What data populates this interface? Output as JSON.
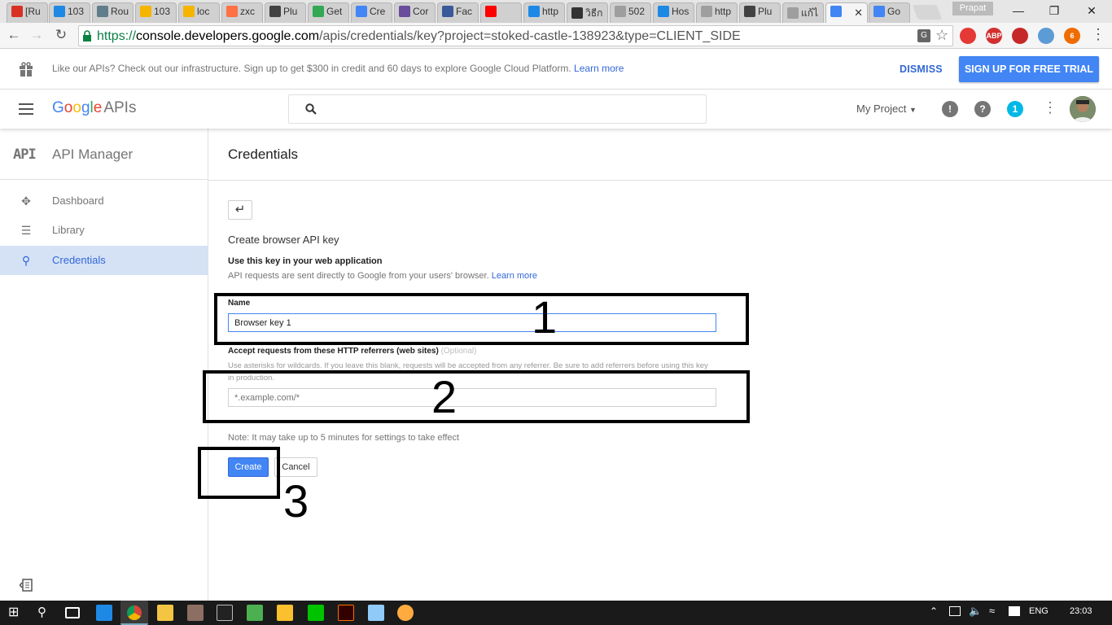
{
  "browser": {
    "tabs": [
      {
        "label": "[Ru",
        "color": "#d93025",
        "icon": "gmail-icon"
      },
      {
        "label": "103",
        "color": "#1e88e5",
        "icon": "site-icon"
      },
      {
        "label": "Rou",
        "color": "#607d8b",
        "icon": "router-icon"
      },
      {
        "label": "103",
        "color": "#f4b400",
        "icon": "pma-icon"
      },
      {
        "label": "loc",
        "color": "#f4b400",
        "icon": "pma-icon"
      },
      {
        "label": "zxc",
        "color": "#ff7043",
        "icon": "site-icon"
      },
      {
        "label": "Plu",
        "color": "#424242",
        "icon": "plugin-icon"
      },
      {
        "label": "Get",
        "color": "#34a853",
        "icon": "site-icon"
      },
      {
        "label": "Cre",
        "color": "#4285f4",
        "icon": "google-icon"
      },
      {
        "label": "Cor",
        "color": "#6a4c9c",
        "icon": "bootstrap-icon"
      },
      {
        "label": "Fac",
        "color": "#3b5998",
        "icon": "facebook-icon"
      },
      {
        "label": "",
        "color": "#ff0000",
        "icon": "youtube-icon"
      },
      {
        "label": "http",
        "color": "#1e88e5",
        "icon": "bird-icon"
      },
      {
        "label": "วิธีก",
        "color": "#333333",
        "icon": "site-icon"
      },
      {
        "label": "502",
        "color": "#9e9e9e",
        "icon": "page-icon"
      },
      {
        "label": "Hos",
        "color": "#1e88e5",
        "icon": "site-icon"
      },
      {
        "label": "http",
        "color": "#9e9e9e",
        "icon": "page-icon"
      },
      {
        "label": "Plu",
        "color": "#424242",
        "icon": "plugin-icon"
      },
      {
        "label": "แก้ไ",
        "color": "#9e9e9e",
        "icon": "page-icon"
      },
      {
        "label": "",
        "color": "#4285f4",
        "icon": "google-icon",
        "active": true
      },
      {
        "label": "Go",
        "color": "#4285f4",
        "icon": "google-icon"
      }
    ],
    "profile_name": "Prapat",
    "url_scheme": "https://",
    "url_host": "console.developers.google.com",
    "url_path": "/apis/credentials/key?project=stoked-castle-138923&type=CLIENT_SIDE",
    "extensions": [
      {
        "icon": "opera-icon",
        "label": "",
        "color": "#e53935"
      },
      {
        "icon": "adblock-icon",
        "label": "ABP",
        "color": "#d32f2f"
      },
      {
        "icon": "fastforward-icon",
        "label": "",
        "color": "#c62828"
      },
      {
        "icon": "extension-icon",
        "label": "",
        "color": "#5c9bd5"
      },
      {
        "icon": "extension-badge-icon",
        "label": "6",
        "color": "#ef6c00"
      }
    ]
  },
  "promo": {
    "text": "Like our APIs? Check out our infrastructure. Sign up to get $300 in credit and 60 days to explore Google Cloud Platform.",
    "link": "Learn more",
    "dismiss": "DISMISS",
    "signup": "SIGN UP FOR FREE TRIAL"
  },
  "header": {
    "logo_google": "Google",
    "logo_apis": "APIs",
    "project": "My Project",
    "notification_count": "1"
  },
  "sidebar": {
    "badge": "API",
    "title": "API Manager",
    "items": [
      {
        "label": "Dashboard",
        "icon": "dashboard-icon"
      },
      {
        "label": "Library",
        "icon": "library-icon"
      },
      {
        "label": "Credentials",
        "icon": "key-icon",
        "selected": true
      }
    ]
  },
  "main": {
    "title": "Credentials",
    "form_title": "Create browser API key",
    "use_key": "Use this key in your web application",
    "api_requests": "API requests are sent directly to Google from your users' browser.",
    "learn_more": "Learn more",
    "name_label": "Name",
    "name_value": "Browser key 1",
    "referrers_label": "Accept requests from these HTTP referrers (web sites)",
    "optional": "(Optional)",
    "referrers_help": "Use asterisks for wildcards. If you leave this blank, requests will be accepted from any referrer. Be sure to add referrers before using this key in production.",
    "referrers_placeholder": "*.example.com/*",
    "note": "Note: It may take up to 5 minutes for settings to take effect",
    "create": "Create",
    "cancel": "Cancel"
  },
  "annotations": [
    "1",
    "2",
    "3"
  ],
  "taskbar": {
    "language": "ENG",
    "time": "23:03"
  },
  "colors": {
    "accent": "#4285f4",
    "link": "#3367d6",
    "selected_bg": "#d5e2f6"
  }
}
